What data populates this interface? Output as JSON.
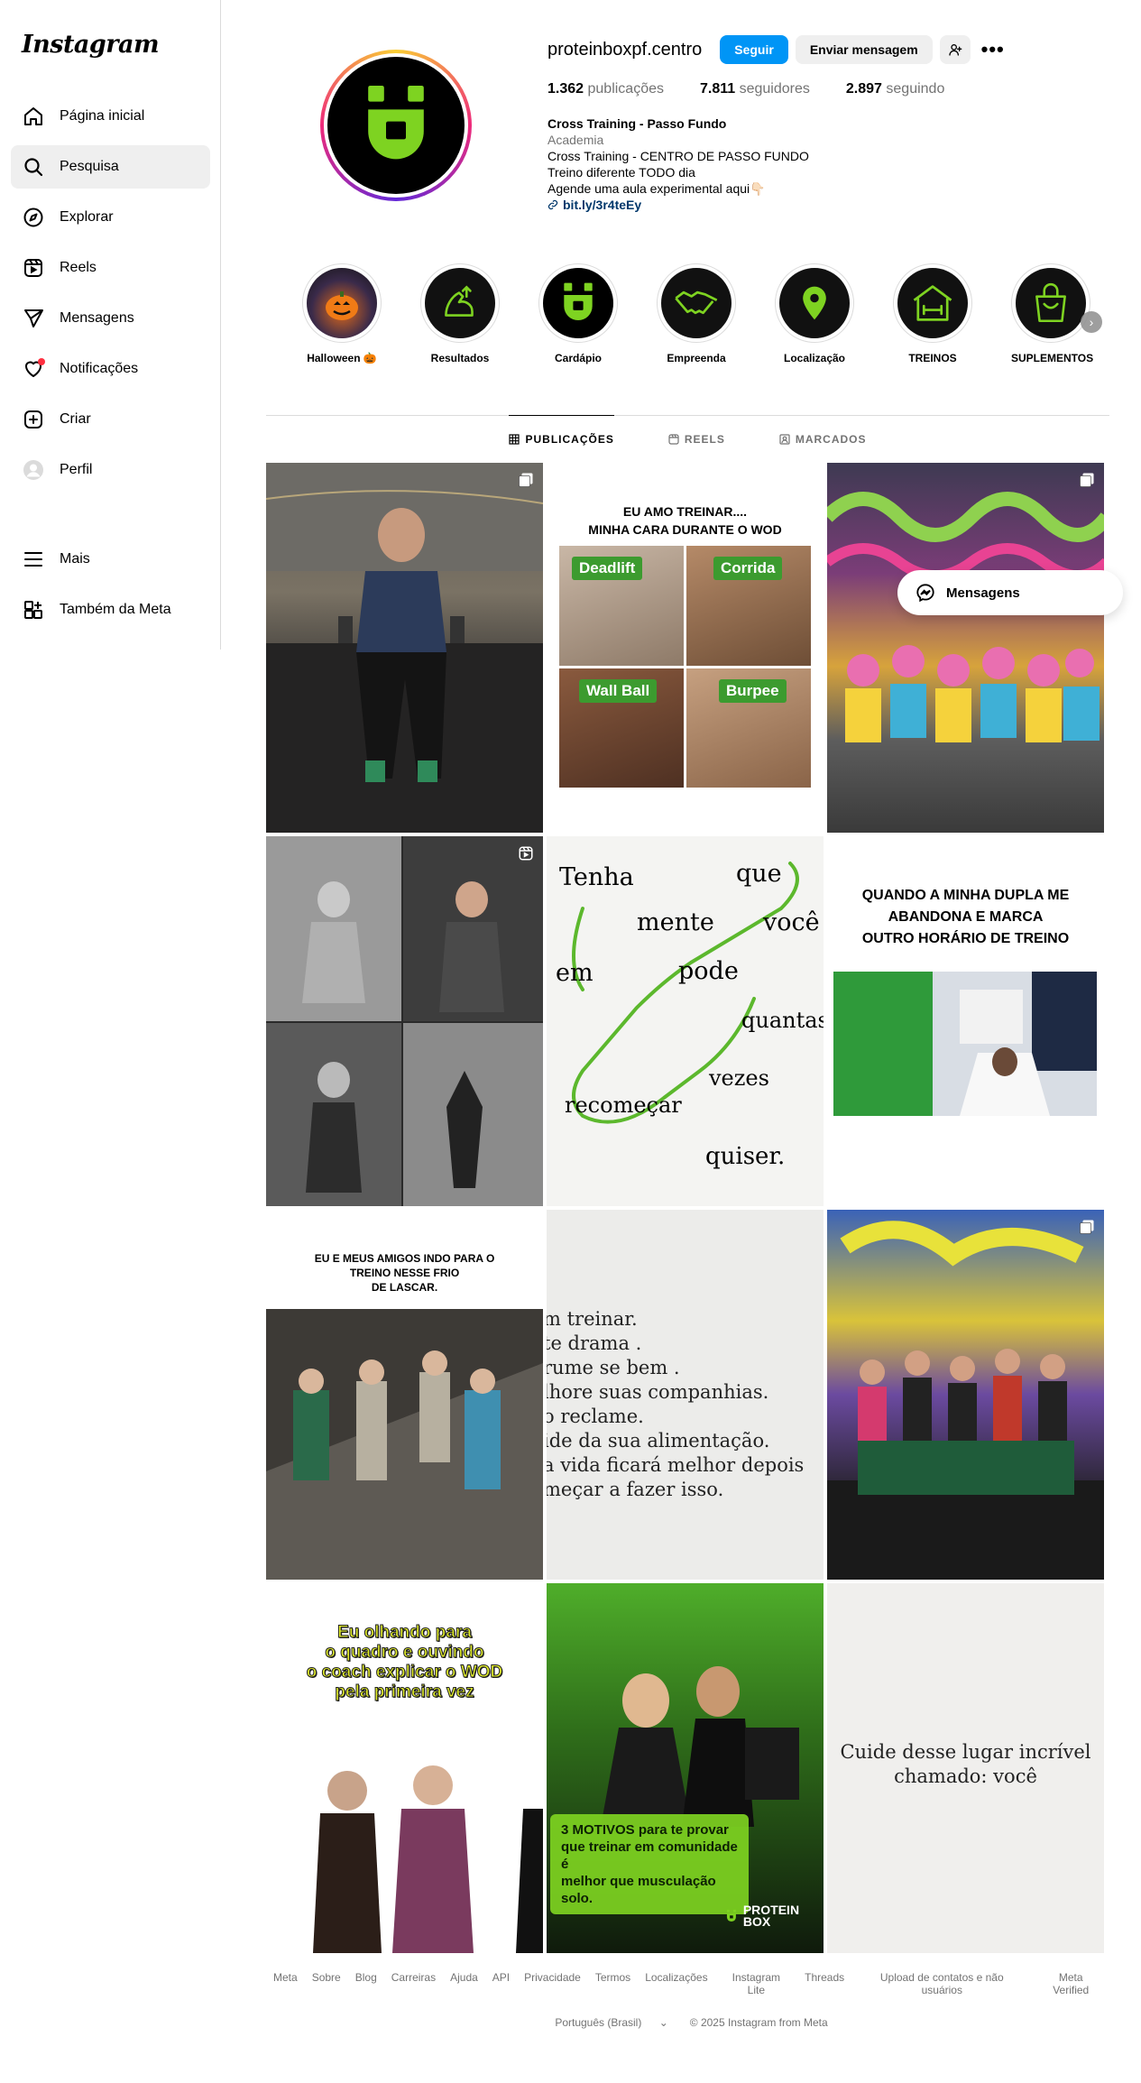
{
  "sidebar": {
    "logo": "Instagram",
    "items": [
      {
        "label": "Página inicial"
      },
      {
        "label": "Pesquisa"
      },
      {
        "label": "Explorar"
      },
      {
        "label": "Reels"
      },
      {
        "label": "Mensagens"
      },
      {
        "label": "Notificações"
      },
      {
        "label": "Criar"
      },
      {
        "label": "Perfil"
      }
    ],
    "more": "Mais",
    "meta": "Também da Meta"
  },
  "profile": {
    "username": "proteinboxpf.centro",
    "follow_label": "Seguir",
    "message_label": "Enviar mensagem",
    "stats": {
      "posts_value": "1.362",
      "posts_label": "publicações",
      "followers_value": "7.811",
      "followers_label": "seguidores",
      "following_value": "2.897",
      "following_label": "seguindo"
    },
    "bio": {
      "name": "Cross Training - Passo Fundo",
      "category": "Academia",
      "line1": "Cross Training - CENTRO DE PASSO FUNDO",
      "line2": "Treino diferente TODO dia",
      "line3": "Agende uma aula experimental aqui👇🏻",
      "link": "bit.ly/3r4teEy"
    }
  },
  "highlights": [
    {
      "label": "Halloween 🎃"
    },
    {
      "label": "Resultados"
    },
    {
      "label": "Cardápio"
    },
    {
      "label": "Empreenda"
    },
    {
      "label": "Localização"
    },
    {
      "label": "TREINOS"
    },
    {
      "label": "SUPLEMENTOS"
    }
  ],
  "tabs": {
    "posts": "PUBLICAÇÕES",
    "reels": "REELS",
    "tagged": "MARCADOS"
  },
  "posts": {
    "p2": {
      "title1": "EU AMO TREINAR....",
      "title2": "MINHA CARA DURANTE O WOD",
      "tag1": "Deadlift",
      "tag2": "Corrida",
      "tag3": "Wall Ball",
      "tag4": "Burpee"
    },
    "p5": {
      "w1": "Tenha",
      "w2": "que",
      "w3": "mente",
      "w4": "você",
      "w5": "em",
      "w6": "pode",
      "w7": "quantas",
      "w8": "vezes",
      "w9": "recomeçar",
      "w10": "quiser."
    },
    "p6": {
      "l1": "QUANDO A MINHA DUPLA ME",
      "l2": "ABANDONA E MARCA",
      "l3": "OUTRO HORÁRIO DE TREINO"
    },
    "p7": {
      "l1": "EU E MEUS AMIGOS INDO PARA O",
      "l2": "TREINO NESSE FRIO",
      "l3": "DE LASCAR."
    },
    "p8": {
      "l1": "m treinar.",
      "l2": "te drama .",
      "l3": "rume se bem .",
      "l4": "lhore suas companhias.",
      "l5": "o reclame.",
      "l6": "ide da sua alimentação.",
      "l7": "a vida ficará melhor depois",
      "l8": "meçar a fazer isso."
    },
    "p10": {
      "l1": "Eu olhando para",
      "l2": "o quadro e ouvindo",
      "l3": "o coach explicar o WOD",
      "l4": "pela primeira vez"
    },
    "p11": {
      "l1": "3 MOTIVOS para te provar",
      "l2": "que treinar em comunidade é",
      "l3": "melhor que musculação solo.",
      "brand": "PROTEIN BOX"
    },
    "p12": {
      "l1": "Cuide desse lugar incrível",
      "l2": "chamado: você"
    }
  },
  "messages_pill": "Mensagens",
  "footer": {
    "links": [
      "Meta",
      "Sobre",
      "Blog",
      "Carreiras",
      "Ajuda",
      "API",
      "Privacidade",
      "Termos",
      "Localizações",
      "Instagram Lite",
      "Threads",
      "Upload de contatos e não usuários",
      "Meta Verified"
    ],
    "language": "Português (Brasil)",
    "copyright": "© 2025 Instagram from Meta"
  },
  "colors": {
    "brand_green": "#7ed321",
    "primary_blue": "#0095f6",
    "link_blue": "#00376b"
  }
}
